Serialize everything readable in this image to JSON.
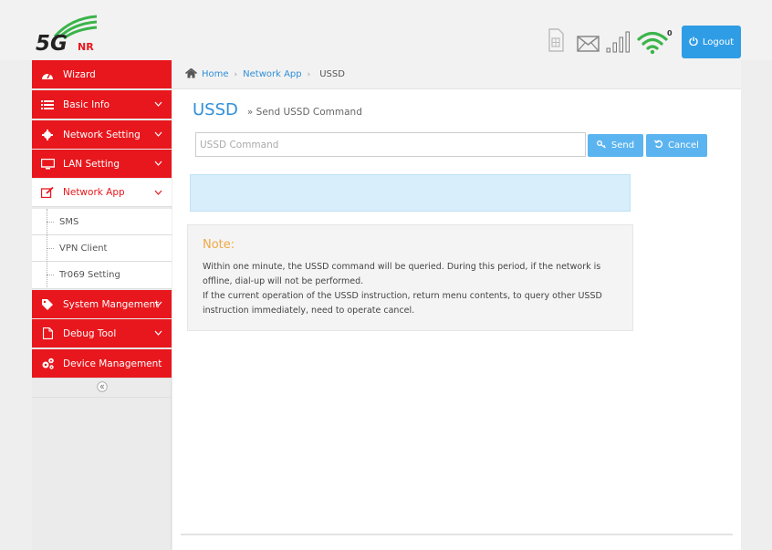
{
  "header": {
    "logo": {
      "main": "5G",
      "sub": "NR"
    },
    "wifi_clients": "0",
    "logout_label": "Logout"
  },
  "sidebar": {
    "items": [
      {
        "label": "Wizard",
        "icon": "dashboard-icon"
      },
      {
        "label": "Basic Info",
        "icon": "list-icon"
      },
      {
        "label": "Network Setting",
        "icon": "gear-icon"
      },
      {
        "label": "LAN Setting",
        "icon": "monitor-icon"
      },
      {
        "label": "Network App",
        "icon": "edit-icon",
        "active": true
      },
      {
        "label": "System Mangement",
        "icon": "tag-icon"
      },
      {
        "label": "Debug Tool",
        "icon": "file-icon"
      },
      {
        "label": "Device Management",
        "icon": "gears-icon"
      }
    ],
    "sub_items": [
      {
        "label": "SMS"
      },
      {
        "label": "VPN Client"
      },
      {
        "label": "Tr069 Setting"
      }
    ]
  },
  "breadcrumb": {
    "home": "Home",
    "section": "Network App",
    "current": "USSD"
  },
  "page": {
    "title": "USSD",
    "subtitle": "Send USSD Command",
    "input_placeholder": "USSD Command",
    "input_value": "",
    "send_label": "Send",
    "cancel_label": "Cancel"
  },
  "note": {
    "title": "Note:",
    "line1": "Within one minute, the USSD command will be queried. During this period, if the network is offline, dial-up will not be performed.",
    "line2": "If the current operation of the USSD instruction, return menu contents, to query other USSD instruction immediately, need to operate cancel."
  },
  "colors": {
    "accent_red": "#e8171d",
    "accent_blue": "#2f8fd8",
    "button_blue": "#5bb4ef",
    "logo_green": "#3bb44a",
    "note_title": "#f0a844"
  }
}
